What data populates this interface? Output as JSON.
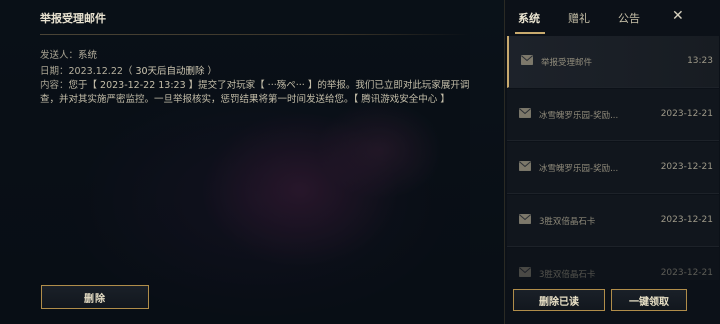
{
  "mail": {
    "title": "举报受理邮件",
    "sender_label": "发送人：",
    "sender_value": "系统",
    "date_label": "日期：",
    "date_value": "2023.12.22",
    "date_note": "（ 30天后自动删除 ）",
    "content_label": "内容：",
    "content_text": "您于【 2023-12-22 13:23 】提交了对玩家【 ···殇ペ··· 】的举报。我们已立即对此玩家展开调查，并对其实施严密监控。一旦举报核实，惩罚结果将第一时间发送给您。【 腾讯游戏安全中心 】",
    "delete_button": "删除"
  },
  "sidebar": {
    "tabs": [
      {
        "label": "系统",
        "active": true
      },
      {
        "label": "赠礼",
        "active": false
      },
      {
        "label": "公告",
        "active": false
      }
    ],
    "close_icon": "close-icon",
    "close_glyph": "✕",
    "items": [
      {
        "subject": "举报受理邮件",
        "date": "13:23",
        "selected": true
      },
      {
        "subject": "冰雪魄罗乐园-奖励...",
        "date": "2023-12-21",
        "selected": false
      },
      {
        "subject": "冰雪魄罗乐园-奖励...",
        "date": "2023-12-21",
        "selected": false
      },
      {
        "subject": "3胜双倍晶石卡",
        "date": "2023-12-21",
        "selected": false
      },
      {
        "subject": "3胜双倍晶石卡",
        "date": "2023-12-21",
        "selected": false
      }
    ],
    "delete_read_button": "删除已读",
    "claim_all_button": "一键领取"
  },
  "colors": {
    "accent_gold": "#c8aa6e",
    "text_main": "#c4bea9",
    "background": "#0c1118"
  }
}
